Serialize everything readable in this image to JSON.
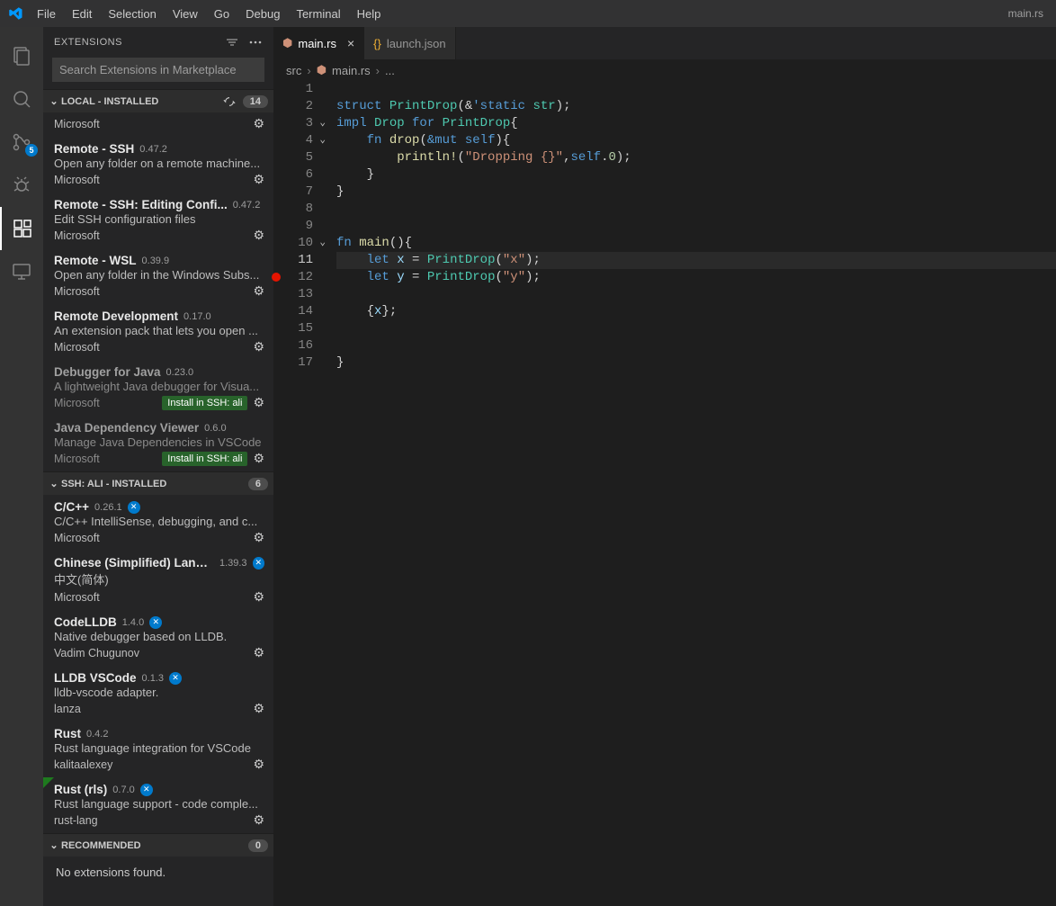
{
  "titlebar": {
    "menu": [
      "File",
      "Edit",
      "Selection",
      "View",
      "Go",
      "Debug",
      "Terminal",
      "Help"
    ],
    "right": "main.rs"
  },
  "activitybar": {
    "scm_badge": "5"
  },
  "sidebar": {
    "title": "EXTENSIONS",
    "search_placeholder": "Search Extensions in Marketplace",
    "sections": {
      "local": {
        "title": "LOCAL - INSTALLED",
        "count": "14"
      },
      "ssh": {
        "title": "SSH: ALI - INSTALLED",
        "count": "6"
      },
      "rec": {
        "title": "RECOMMENDED",
        "count": "0",
        "empty": "No extensions found."
      }
    },
    "local": [
      {
        "name": "Remote - SSH",
        "ver": "0.47.2",
        "desc": "Open any folder on a remote machine...",
        "pub": "Microsoft"
      },
      {
        "name": "Remote - SSH: Editing Confi...",
        "ver": "0.47.2",
        "desc": "Edit SSH configuration files",
        "pub": "Microsoft"
      },
      {
        "name": "Remote - WSL",
        "ver": "0.39.9",
        "desc": "Open any folder in the Windows Subs...",
        "pub": "Microsoft"
      },
      {
        "name": "Remote Development",
        "ver": "0.17.0",
        "desc": "An extension pack that lets you open ...",
        "pub": "Microsoft"
      },
      {
        "name": "Debugger for Java",
        "ver": "0.23.0",
        "desc": "A lightweight Java debugger for Visua...",
        "pub": "Microsoft",
        "install": "Install in SSH: ali"
      },
      {
        "name": "Java Dependency Viewer",
        "ver": "0.6.0",
        "desc": "Manage Java Dependencies in VSCode",
        "pub": "Microsoft",
        "install": "Install in SSH: ali"
      }
    ],
    "local_head_pub": "Microsoft",
    "ssh": [
      {
        "name": "C/C++",
        "ver": "0.26.1",
        "desc": "C/C++ IntelliSense, debugging, and c...",
        "pub": "Microsoft",
        "blue": true
      },
      {
        "name": "Chinese (Simplified) Langu...",
        "ver": "1.39.3",
        "desc": "中文(简体)",
        "pub": "Microsoft",
        "blue": true
      },
      {
        "name": "CodeLLDB",
        "ver": "1.4.0",
        "desc": "Native debugger based on LLDB.",
        "pub": "Vadim Chugunov",
        "blue": true
      },
      {
        "name": "LLDB VSCode",
        "ver": "0.1.3",
        "desc": "lldb-vscode adapter.",
        "pub": "lanza",
        "blue": true
      },
      {
        "name": "Rust",
        "ver": "0.4.2",
        "desc": "Rust language integration for VSCode",
        "pub": "kalitaalexey"
      },
      {
        "name": "Rust (rls)",
        "ver": "0.7.0",
        "desc": "Rust language support - code comple...",
        "pub": "rust-lang",
        "blue": true,
        "star": true
      }
    ]
  },
  "tabs": [
    {
      "icon": "rs",
      "label": "main.rs",
      "active": true,
      "close": true
    },
    {
      "icon": "json",
      "label": "launch.json",
      "active": false,
      "close": false
    }
  ],
  "breadcrumbs": {
    "a": "src",
    "b": "main.rs",
    "c": "..."
  },
  "code": {
    "lines": 17,
    "current": 11,
    "breakpoint": 12,
    "folds": [
      3,
      4,
      10
    ],
    "t": {
      "struct": "struct",
      "impl": "impl",
      "Drop": "Drop",
      "for": "for",
      "PrintDrop": "PrintDrop",
      "static": "static",
      "str": "str",
      "fn": "fn",
      "drop": "drop",
      "mut": "&mut",
      "self": "self",
      "println": "println!",
      "dropstr": "\"Dropping {}\"",
      "main": "main",
      "let": "let",
      "x": "x",
      "y": "y",
      "sx": "\"x\"",
      "sy": "\"y\"",
      "zero": "0",
      "amp": "&",
      "tick": "'"
    }
  }
}
